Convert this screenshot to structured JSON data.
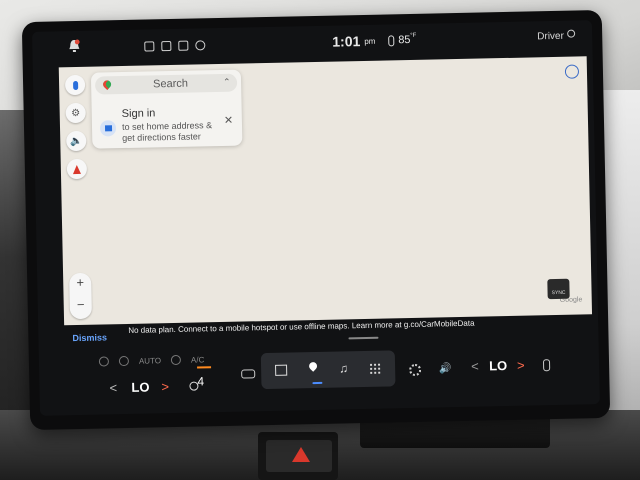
{
  "status_bar": {
    "time": "1:01",
    "ampm": "pm",
    "temperature": "85",
    "temperature_unit": "°F",
    "profile_label": "Driver"
  },
  "map": {
    "search_label": "Search",
    "signin_title": "Sign in",
    "signin_desc": "to set home address & get directions faster",
    "zoom_in": "+",
    "zoom_out": "−",
    "watermark": "Google"
  },
  "banner": {
    "dismiss_label": "Dismiss",
    "message": "No data plan. Connect to a mobile hotspot or use offline maps. Learn more at g.co/CarMobileData"
  },
  "climate": {
    "auto_label": "AUTO",
    "ac_label": "A/C",
    "left_temp": "LO",
    "right_temp": "LO",
    "fan_speed": "4",
    "sync_label": "SYNC"
  },
  "icons": {
    "chev_left": "<",
    "chev_right": ">"
  },
  "colors": {
    "accent_blue": "#6aa6ff",
    "warm_red": "#ff6a4d",
    "fan_orange": "#ff8a1f"
  }
}
